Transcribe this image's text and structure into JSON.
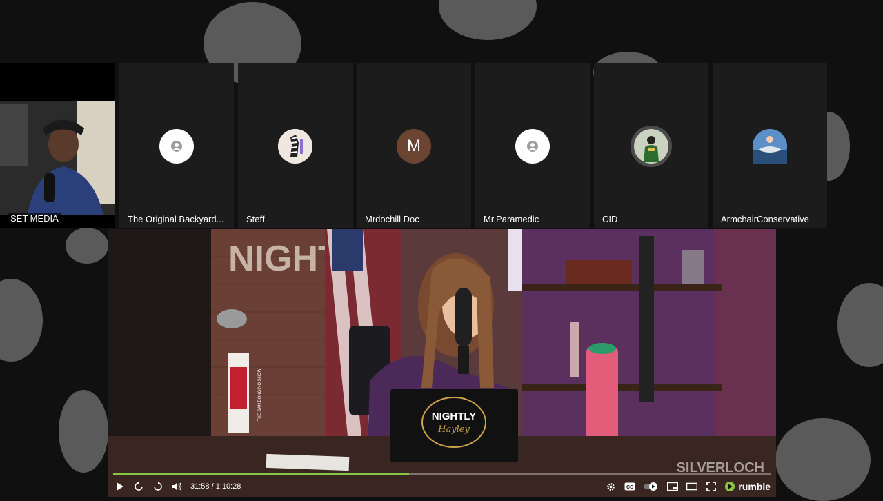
{
  "participants": [
    {
      "name": "SET MEDIA",
      "type": "camera"
    },
    {
      "name": "The Original Backyard...",
      "avatar": "person-icon"
    },
    {
      "name": "Steff",
      "avatar": "photo-zebra"
    },
    {
      "name": "Mrdochill Doc",
      "avatar_letter": "M"
    },
    {
      "name": "Mr.Paramedic",
      "avatar": "person-icon"
    },
    {
      "name": "CID",
      "avatar": "photo-person"
    },
    {
      "name": "ArmchairConservative",
      "avatar": "photo-boat"
    }
  ],
  "player": {
    "time": "31:58 / 1:10:28",
    "progress": 0.45,
    "brand": "rumble",
    "watermark": "SILVERLOCH",
    "accent": "#85c742"
  },
  "video_scene": {
    "sign_text": "NIGHTLY",
    "laptop_line1": "NIGHTLY",
    "laptop_line2": "Hayley",
    "mic_flag_text": "THE DAN BONGINO SHOW"
  }
}
